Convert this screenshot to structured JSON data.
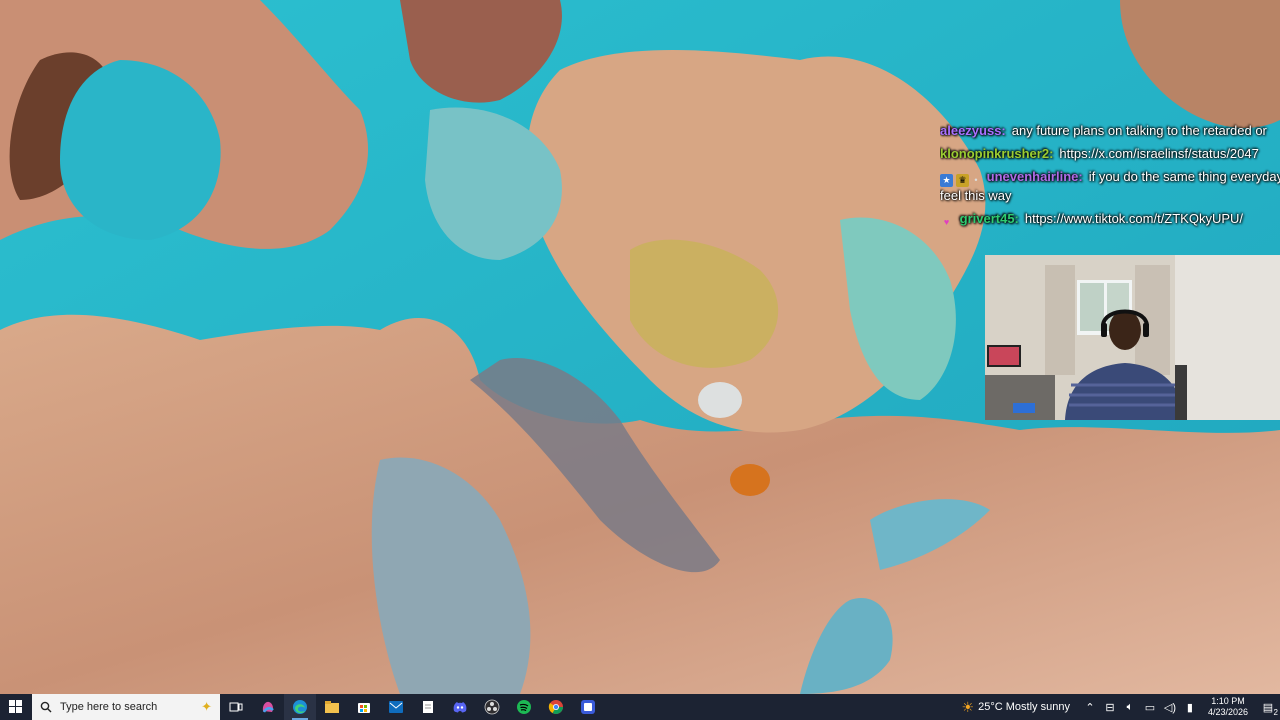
{
  "chat": {
    "messages": [
      {
        "user": "aleezyuss:",
        "text": "any future plans on talking to the retarded or",
        "color": "#a970ff",
        "badges": []
      },
      {
        "user": "klonopinkrusher2:",
        "text": "https://x.com/israelinsf/status/2047",
        "color": "#9acd32",
        "badges": []
      },
      {
        "user": "unevenhairline:",
        "text": "if you do the same thing everyday feel this way",
        "color": "#b06be6",
        "badges": [
          "badge-a-icon",
          "badge-b-icon",
          "badge-c-icon"
        ]
      },
      {
        "user": "grivert45:",
        "text": "https://www.tiktok.com/t/ZTKQkyUPU/",
        "color": "#2ecc71",
        "badges": [
          "heart-badge-icon"
        ]
      }
    ]
  },
  "taskbar": {
    "search_placeholder": "Type here to search",
    "pinned": [
      "task-view-icon",
      "copilot-icon",
      "edge-icon",
      "file-explorer-icon",
      "store-icon",
      "outlook-icon",
      "notepad-icon",
      "discord-icon",
      "obs-icon",
      "spotify-icon",
      "chrome-icon",
      "app-icon"
    ],
    "weather_temp": "25°C",
    "weather_text": "Mostly sunny",
    "time": "1:10 PM",
    "date": "4/23/2026",
    "notification_count": "2",
    "colors": {
      "bg": "#1c2333",
      "accent": "#6aa7e0"
    }
  }
}
